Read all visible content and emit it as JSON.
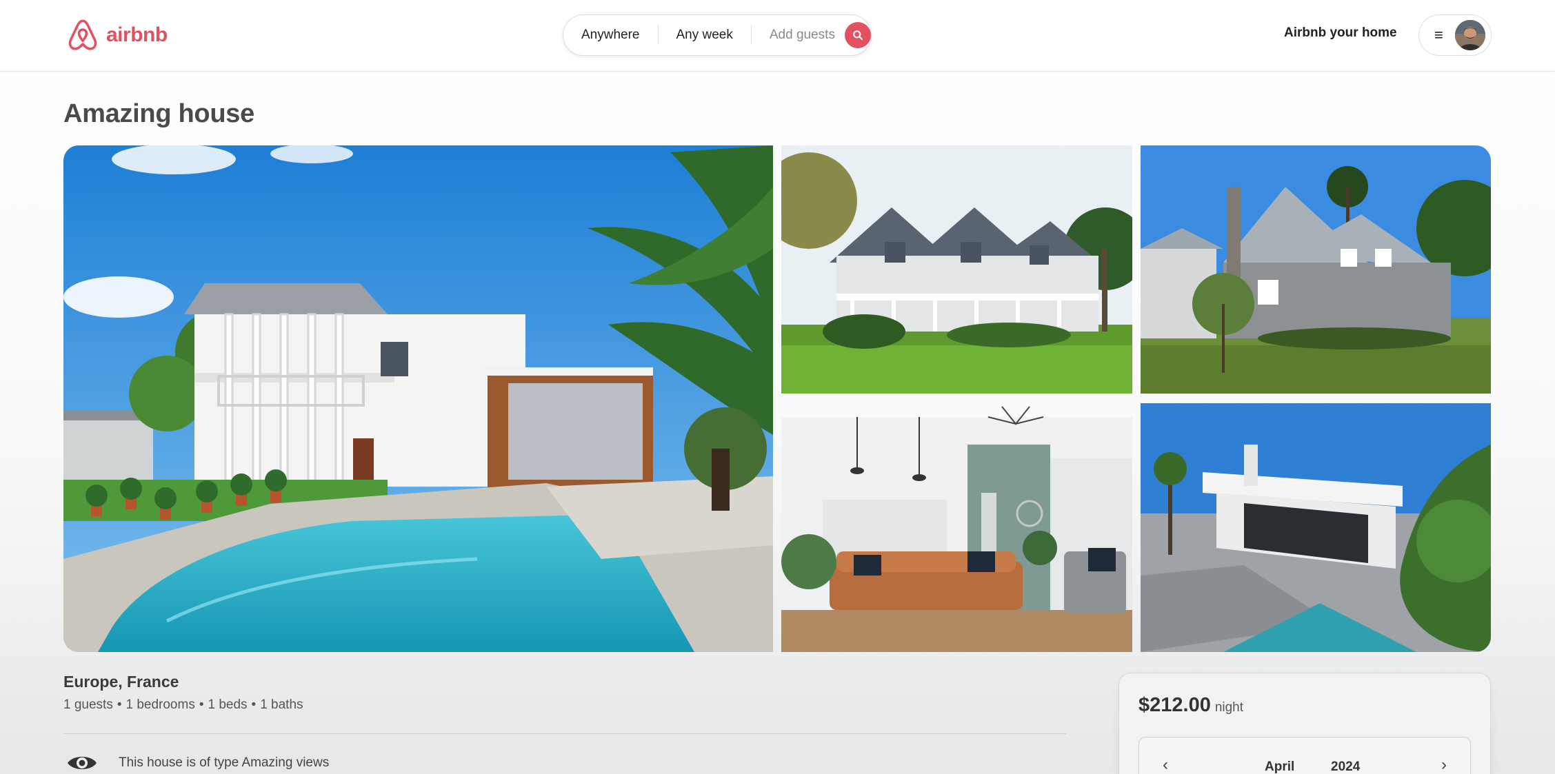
{
  "brand": {
    "name": "airbnb",
    "color": "#e1515f",
    "logo_icon": "airbnb-belo-icon"
  },
  "search": {
    "location": "Anywhere",
    "dates": "Any week",
    "guests_placeholder": "Add guests",
    "button_icon": "search-icon"
  },
  "header": {
    "host_link": "Airbnb your home",
    "menu_icon": "hamburger-icon",
    "avatar_icon": "user-avatar"
  },
  "listing": {
    "title": "Amazing house",
    "photos": [
      {
        "name": "white house with pool and palm trees"
      },
      {
        "name": "grey shingle house with porch"
      },
      {
        "name": "grey craftsman house with lawn"
      },
      {
        "name": "living room with leather sofa"
      },
      {
        "name": "modern white villa with pool"
      }
    ],
    "location": "Europe, France",
    "specs": [
      "1 guests",
      "1 bedrooms",
      "1 beds",
      "1 baths"
    ],
    "spec_separator": "•",
    "feature": {
      "icon": "eye-icon",
      "text": "This house is of type Amazing views"
    }
  },
  "booking": {
    "price": "$212.00",
    "unit": "night",
    "calendar": {
      "month": "April",
      "year": "2024",
      "prev_icon": "chevron-left-icon",
      "next_icon": "chevron-right-icon"
    }
  }
}
